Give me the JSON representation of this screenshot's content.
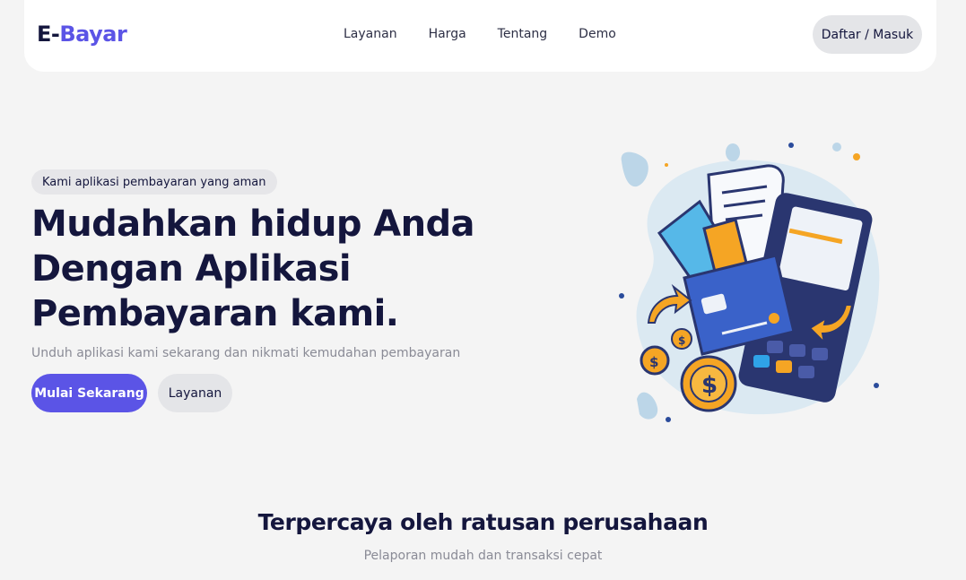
{
  "brand": {
    "prefix": "E-",
    "accent": "Bayar"
  },
  "nav": {
    "links": [
      "Layanan",
      "Harga",
      "Tentang",
      "Demo"
    ],
    "auth_label": "Daftar / Masuk"
  },
  "hero": {
    "badge": "Kami aplikasi pembayaran yang aman",
    "headline_lines": [
      "Mudahkan hidup Anda",
      "Dengan Aplikasi",
      "Pembayaran kami."
    ],
    "subtitle": "Unduh aplikasi kami sekarang dan nikmati kemudahan pembayaran",
    "primary_cta": "Mulai Sekarang",
    "secondary_cta": "Layanan",
    "illustration_icon": "payment-illustration"
  },
  "trust": {
    "title": "Terpercaya oleh ratusan perusahaan",
    "subtitle": "Pelaporan mudah dan transaksi cepat"
  },
  "colors": {
    "accent": "#5b54e6",
    "dark_text": "#14163d",
    "muted_text": "#8a8b96",
    "background": "#f4f4f4",
    "pill_gray": "#e4e5e8"
  }
}
